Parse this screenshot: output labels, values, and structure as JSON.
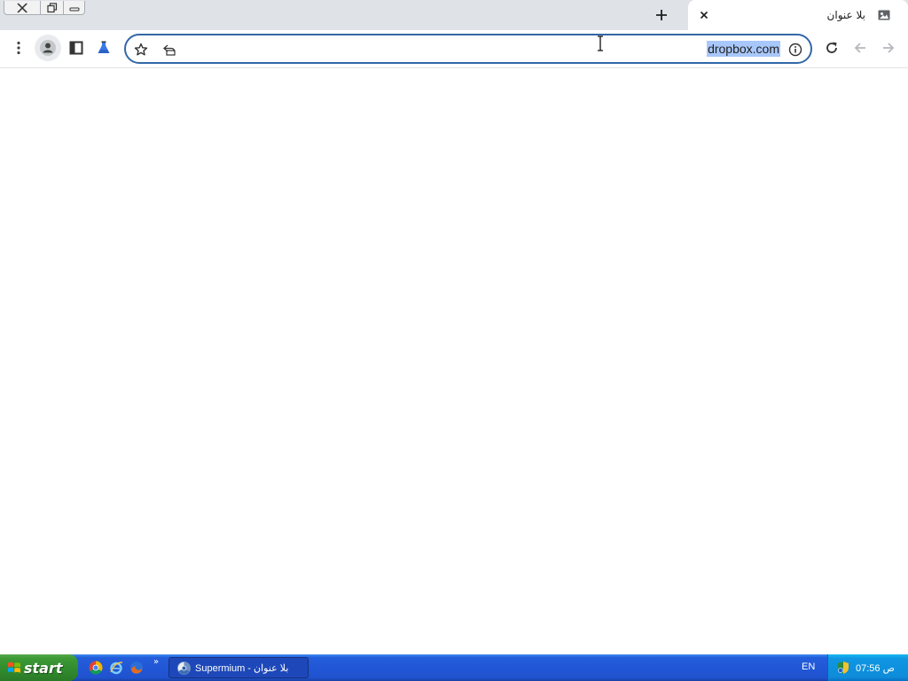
{
  "window_controls": {
    "close_icon": "close-icon",
    "restore_icon": "restore-icon",
    "minimize_icon": "minimize-icon"
  },
  "tabs": [
    {
      "title": "بلا عنوان",
      "favicon": "tab-favicon-icon",
      "active": true
    }
  ],
  "toolbar": {
    "menu_icon": "kebab-menu-icon",
    "profile_icon": "profile-icon",
    "side_panel_icon": "side-panel-icon",
    "labs_icon": "labs-flask-icon",
    "reload_icon": "reload-icon",
    "back_icon": "back-arrow-icon",
    "forward_icon": "forward-arrow-icon"
  },
  "omnibox": {
    "url": "dropbox.com",
    "selected": true,
    "bookmark_icon": "star-icon",
    "share_icon": "share-icon",
    "site_info_icon": "info-icon"
  },
  "taskbar": {
    "start_label": "start",
    "quick_launch": [
      "chrome-icon",
      "internet-explorer-icon",
      "firefox-icon"
    ],
    "task_button_label": "Supermium - بلا عنوان",
    "language": "EN",
    "clock": "07:56 ص"
  },
  "colors": {
    "tabstrip": "#dfe3e8",
    "omnibox_border": "#3367a8",
    "url_selection": "#a8c7fa",
    "taskbar_blue": "#245edb",
    "start_green": "#3c9a35",
    "tray_blue": "#0f96e3"
  }
}
